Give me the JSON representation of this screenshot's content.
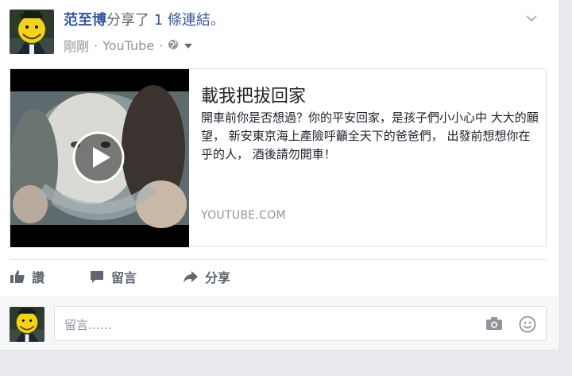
{
  "post": {
    "author": "范至博",
    "shared_text": "分享了",
    "link_count": "1 條連結",
    "punct": "。",
    "timestamp": "剛剛",
    "separator": "·",
    "source": "YouTube",
    "privacy_icon": "globe-icon"
  },
  "link_preview": {
    "title": "載我把拔回家",
    "description": "開車前你是否想過？你的平安回家，是孩子們小小心中 大大的願望， 新安東京海上產險呼籲全天下的爸爸們， 出發前想想你在乎的人， 酒後請勿開車！",
    "source": "YOUTUBE.COM"
  },
  "actions": {
    "like": "讚",
    "comment": "留言",
    "share": "分享"
  },
  "comment_box": {
    "placeholder": "留言……"
  },
  "colors": {
    "link_blue": "#365899",
    "secondary_text": "#90949c",
    "background": "#e9ebee"
  }
}
